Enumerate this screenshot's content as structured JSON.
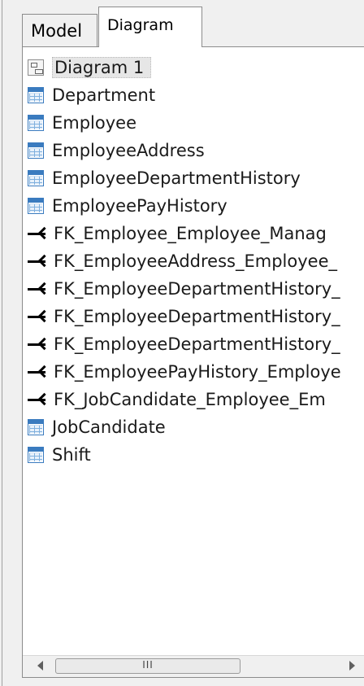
{
  "tabs": [
    {
      "label": "Model",
      "active": false
    },
    {
      "label": "Diagram",
      "active": true
    }
  ],
  "tree": {
    "items": [
      {
        "label": "Diagram 1",
        "icon": "diagram-icon",
        "selected": true
      },
      {
        "label": "Department",
        "icon": "table-icon"
      },
      {
        "label": "Employee",
        "icon": "table-icon"
      },
      {
        "label": "EmployeeAddress",
        "icon": "table-icon"
      },
      {
        "label": "EmployeeDepartmentHistory",
        "icon": "table-icon"
      },
      {
        "label": "EmployeePayHistory",
        "icon": "table-icon"
      },
      {
        "label": "FK_Employee_Employee_Manag",
        "icon": "relationship-icon"
      },
      {
        "label": "FK_EmployeeAddress_Employee_",
        "icon": "relationship-icon"
      },
      {
        "label": "FK_EmployeeDepartmentHistory_",
        "icon": "relationship-icon"
      },
      {
        "label": "FK_EmployeeDepartmentHistory_",
        "icon": "relationship-icon"
      },
      {
        "label": "FK_EmployeeDepartmentHistory_",
        "icon": "relationship-icon"
      },
      {
        "label": "FK_EmployeePayHistory_Employe",
        "icon": "relationship-icon"
      },
      {
        "label": "FK_JobCandidate_Employee_Em",
        "icon": "relationship-icon"
      },
      {
        "label": "JobCandidate",
        "icon": "table-icon"
      },
      {
        "label": "Shift",
        "icon": "table-icon"
      }
    ]
  },
  "scrollbar": {
    "thumb_grip": "III"
  }
}
